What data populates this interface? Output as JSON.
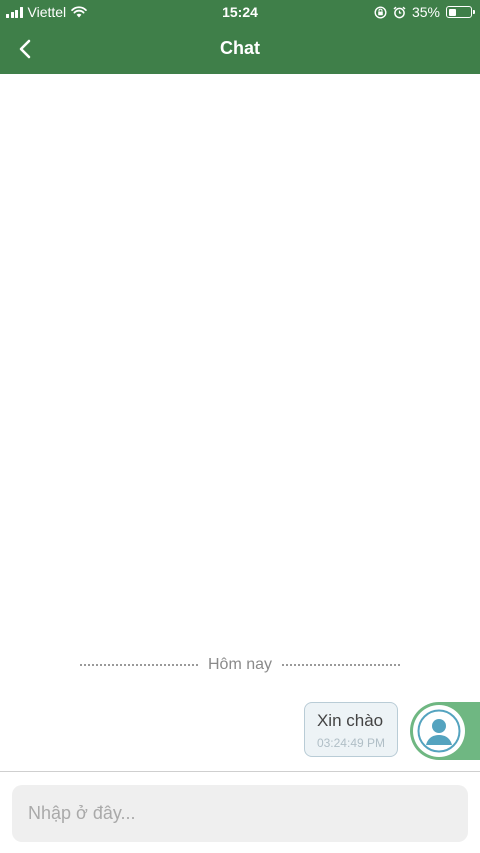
{
  "status_bar": {
    "carrier": "Viettel",
    "time": "15:24",
    "battery_percent": "35%",
    "battery_level": 0.35,
    "icons": [
      "signal-icon",
      "wifi-icon",
      "orientation-lock-icon",
      "alarm-icon",
      "battery-icon"
    ]
  },
  "header": {
    "title": "Chat",
    "back_icon": "chevron-left-icon",
    "background": "#3f7f49"
  },
  "conversation": {
    "date_divider": "Hôm nay",
    "messages": [
      {
        "text": "Xin chào",
        "time": "03:24:49 PM",
        "sender": "self"
      }
    ]
  },
  "composer": {
    "placeholder": "Nhập ở đây..."
  },
  "colors": {
    "accent": "#3f7f49",
    "avatar_accent": "#6fb782",
    "bubble_bg": "#edf3f6",
    "bubble_border": "#b9ccd6"
  }
}
